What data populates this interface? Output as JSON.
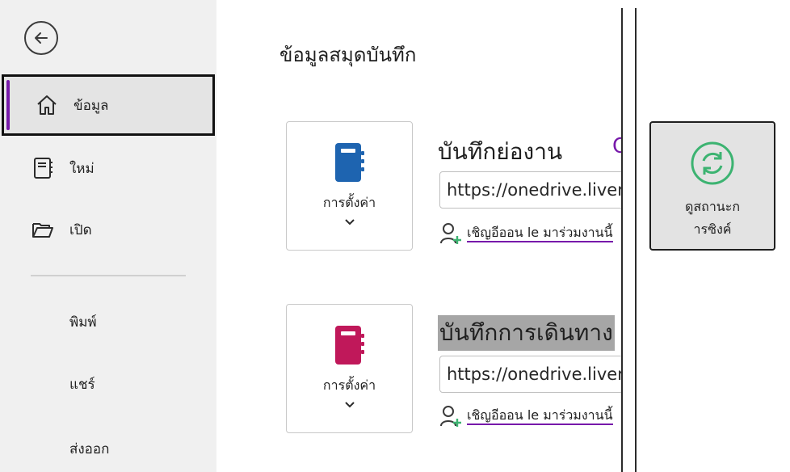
{
  "sidebar": {
    "items": [
      {
        "label": "ข้อมูล",
        "icon": "home-icon",
        "selected": true
      },
      {
        "label": "ใหม่",
        "icon": "new-notebook-icon"
      },
      {
        "label": "เปิด",
        "icon": "folder-open-icon"
      },
      {
        "label": "พิมพ์"
      },
      {
        "label": "แชร์"
      },
      {
        "label": "ส่งออก"
      }
    ]
  },
  "main": {
    "title": "ข้อมูลสมุดบันทึก",
    "notebooks": [
      {
        "name": "บันทึกย่องาน",
        "settings_label": "การตั้งค่า",
        "url": "https://onedrive.liver",
        "invite_label": "เชิญอีออน le มาร่วมงานนี้",
        "icon_color": "#1e64b0"
      },
      {
        "name": "บันทึกการเดินทาง",
        "settings_label": "การตั้งค่า",
        "url": "https://onedrive.liver",
        "invite_label": "เชิญอีออน le มาร่วมงานนี้",
        "icon_color": "#c0185a"
      }
    ],
    "clipped_char": "C",
    "sync": {
      "line1": "ดูสถานะก",
      "line2": "ารซิงค์"
    }
  },
  "colors": {
    "accent": "#7719aa",
    "sync_green": "#3cb371"
  }
}
